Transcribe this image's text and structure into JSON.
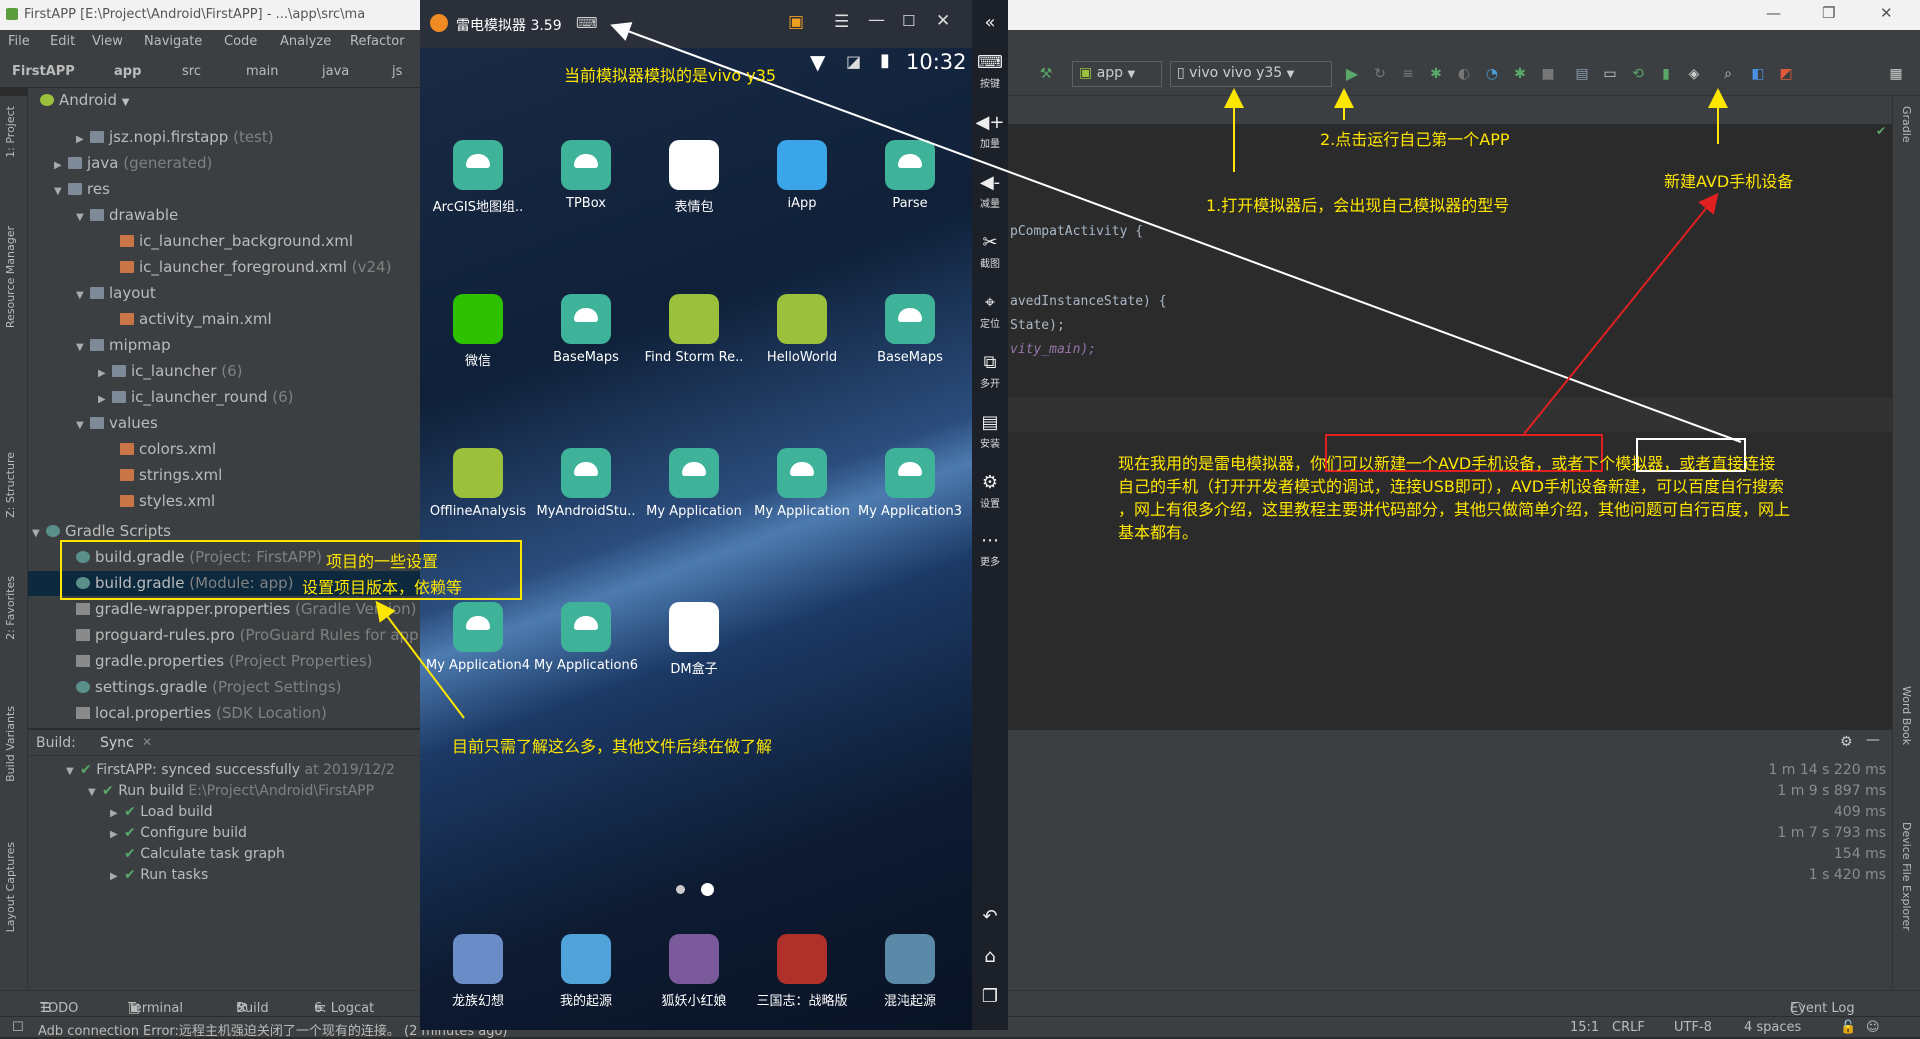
{
  "window": {
    "title": "FirstAPP [E:\\Project\\Android\\FirstAPP] - ...\\app\\src\\ma"
  },
  "menu": [
    "File",
    "Edit",
    "View",
    "Navigate",
    "Code",
    "Analyze",
    "Refactor"
  ],
  "nav": {
    "project": "FirstAPP",
    "module": "app",
    "p1": "src",
    "p2": "main",
    "p3": "java",
    "p4": "js"
  },
  "toolbar": {
    "config": "app",
    "device": "vivo vivo y35"
  },
  "project_view": {
    "label": "Android"
  },
  "tree": {
    "test_pkg": "jsz.nopi.firstapp",
    "test_pkg_hint": "(test)",
    "java_gen": "java",
    "java_gen_hint": "(generated)",
    "res": "res",
    "drawable": "drawable",
    "icbg": "ic_launcher_background.xml",
    "icfg": "ic_launcher_foreground.xml",
    "icfg_hint": "(v24)",
    "layout": "layout",
    "actmain": "activity_main.xml",
    "mipmap": "mipmap",
    "iclauncher": "ic_launcher",
    "iclauncher_hint": "(6)",
    "icround": "ic_launcher_round",
    "icround_hint": "(6)",
    "values": "values",
    "colors": "colors.xml",
    "strings": "strings.xml",
    "styles": "styles.xml",
    "gradle_scripts": "Gradle Scripts",
    "bg1": "build.gradle",
    "bg1_hint": "(Project: FirstAPP)",
    "bg2": "build.gradle",
    "bg2_hint": "(Module: app)",
    "gw": "gradle-wrapper.properties",
    "gw_hint": "(Gradle Version)",
    "pg": "proguard-rules.pro",
    "pg_hint": "(ProGuard Rules for app)",
    "gp": "gradle.properties",
    "gp_hint": "(Project Properties)",
    "sg": "settings.gradle",
    "sg_hint": "(Project Settings)",
    "lp": "local.properties",
    "lp_hint": "(SDK Location)"
  },
  "build": {
    "label": "Build:",
    "sync": "Sync",
    "r1": "FirstAPP:",
    "r1b": "synced successfully",
    "r1c": "at 2019/12/2",
    "r2": "Run build",
    "r2b": "E:\\Project\\Android\\FirstAPP",
    "r3": "Load build",
    "r4": "Configure build",
    "r5": "Calculate task graph",
    "r6": "Run tasks",
    "durations": [
      "1 m 14 s 220 ms",
      "1 m 9 s 897 ms",
      "409 ms",
      "1 m 7 s 793 ms",
      "154 ms",
      "1 s 420 ms"
    ]
  },
  "code": {
    "l1": "pCompatActivity {",
    "l2": "avedInstanceState) {",
    "l3": "State);",
    "l4": "vity_main);"
  },
  "left_tabs": [
    "1: Project",
    "Resource Manager",
    "Z: Structure",
    "2: Favorites",
    "Build Variants",
    "Layout Captures"
  ],
  "right_tabs": [
    "Gradle",
    "Word Book",
    "Device File Explorer"
  ],
  "bottom_tabs": {
    "todo": "TODO",
    "terminal": "Terminal",
    "build": "Build",
    "logcat": "6: Logcat",
    "eventlog": "Event Log"
  },
  "status": {
    "msg": "Adb connection Error:远程主机强迫关闭了一个现有的连接。 (2 minutes ago)",
    "pos": "15:1",
    "crlf": "CRLF",
    "enc": "UTF-8",
    "indent": "4 spaces"
  },
  "emulator": {
    "title": "雷电模拟器 3.59",
    "time": "10:32",
    "side": [
      "按键",
      "加量",
      "减量",
      "截图",
      "定位",
      "多开",
      "安装",
      "设置",
      "更多"
    ],
    "apps": [
      {
        "name": "ArcGIS地图组..",
        "color": "#3fb39a",
        "droid": true
      },
      {
        "name": "TPBox",
        "color": "#3fb39a",
        "droid": true
      },
      {
        "name": "表情包",
        "color": "#ffffff",
        "droid": false
      },
      {
        "name": "iApp",
        "color": "#3aa5e8",
        "droid": false
      },
      {
        "name": "Parse",
        "color": "#3fb39a",
        "droid": true
      },
      {
        "name": "微信",
        "color": "#2dc100",
        "droid": false
      },
      {
        "name": "BaseMaps",
        "color": "#3fb39a",
        "droid": true
      },
      {
        "name": "Find Storm Re..",
        "color": "#9bc13c",
        "droid": false
      },
      {
        "name": "HelloWorld",
        "color": "#9bc13c",
        "droid": false
      },
      {
        "name": "BaseMaps",
        "color": "#3fb39a",
        "droid": true
      },
      {
        "name": "OfflineAnalysis",
        "color": "#9bc13c",
        "droid": false
      },
      {
        "name": "MyAndroidStu..",
        "color": "#3fb39a",
        "droid": true
      },
      {
        "name": "My Application",
        "color": "#3fb39a",
        "droid": true
      },
      {
        "name": "My Application",
        "color": "#3fb39a",
        "droid": true
      },
      {
        "name": "My Application3",
        "color": "#3fb39a",
        "droid": true
      },
      {
        "name": "My Application4",
        "color": "#3fb39a",
        "droid": true
      },
      {
        "name": "My Application6",
        "color": "#3fb39a",
        "droid": true
      },
      {
        "name": "DM盒子",
        "color": "#ffffff",
        "droid": false
      }
    ],
    "dock": [
      {
        "name": "龙族幻想",
        "color": "#6a8cc7"
      },
      {
        "name": "我的起源",
        "color": "#4fa3d8"
      },
      {
        "name": "狐妖小红娘",
        "color": "#7a5a9a"
      },
      {
        "name": "三国志：战略版",
        "color": "#b0302a"
      },
      {
        "name": "混沌起源",
        "color": "#5a8aa8"
      }
    ]
  },
  "annotations": {
    "a1": "当前模拟器模拟的是vivo y35",
    "a2": "2.点击运行自己第一个APP",
    "a3": "1.打开模拟器后，会出现自己模拟器的型号",
    "a4": "新建AVD手机设备",
    "a5": "项目的一些设置",
    "a6": "设置项目版本，依赖等",
    "a7": "目前只需了解这么多，其他文件后续在做了解",
    "p1a": "现在我用的是雷电模拟器，",
    "p1b": "你们可以新建一个AVD手机设备，",
    "p1c": "或者",
    "p1d": "下个模拟器，",
    "p1e": "或者直接连接",
    "p2": "自己的手机（打开开发者模式的调试，连接USB即可），AVD手机设备新建，可以百度自行搜索",
    "p3": "，网上有很多介绍，这里教程主要讲代码部分，其他只做简单介绍，其他问题可自行百度，网上",
    "p4": "基本都有。"
  },
  "colors": {
    "annotation": "#ffe600",
    "arrow_white": "#ffffff",
    "arrow_red": "#e02020",
    "run_green": "#59a869"
  }
}
